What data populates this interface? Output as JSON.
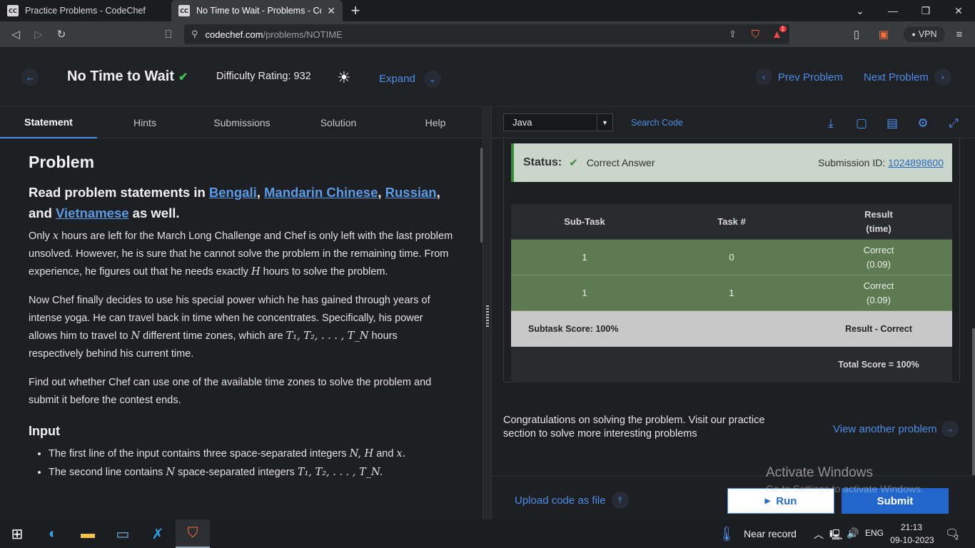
{
  "browser": {
    "tabs": [
      {
        "title": "Practice Problems - CodeChef",
        "favicon": "CC"
      },
      {
        "title": "No Time to Wait - Problems - Co",
        "favicon": "CC"
      }
    ],
    "url_host": "codechef.com",
    "url_path": "/problems/NOTIME",
    "vpn_label": "VPN",
    "badge_count": "1"
  },
  "header": {
    "title": "No Time to Wait",
    "difficulty": "Difficulty Rating: 932",
    "expand": "Expand",
    "prev": "Prev Problem",
    "next": "Next Problem"
  },
  "left_tabs": [
    "Statement",
    "Hints",
    "Submissions",
    "Solution",
    "Help"
  ],
  "statement": {
    "heading": "Problem",
    "read_prefix": "Read problem statements in",
    "langs": [
      "Bengali",
      "Mandarin Chinese",
      "Russian"
    ],
    "read_and": "and",
    "lang_last": "Vietnamese",
    "read_suffix": "as well.",
    "p1a": "Only",
    "p1x": "x",
    "p1b": "hours are left for the March Long Challenge and Chef is only left with the last problem unsolved. However, he is sure that he cannot solve the problem in the remaining time. From experience, he figures out that he needs exactly",
    "p1h": "H",
    "p1c": "hours to solve the problem.",
    "p2a": "Now Chef finally decides to use his special power which he has gained through years of intense yoga. He can travel back in time when he concentrates. Specifically, his power allows him to travel to",
    "p2n": "N",
    "p2b": "different time zones, which are",
    "p2t": "T₁, T₂, . . . , T_N",
    "p2c": "hours respectively behind his current time.",
    "p3": "Find out whether Chef can use one of the available time zones to solve the problem and submit it before the contest ends.",
    "input_heading": "Input",
    "b1a": "The first line of the input contains three space-separated integers",
    "b1m": "N, H",
    "b1and": "and",
    "b1x": "x.",
    "b2a": "The second line contains",
    "b2n": "N",
    "b2b": "space-separated integers",
    "b2t": "T₁, T₂, . . . , T_N."
  },
  "editor": {
    "language": "Java",
    "search_code": "Search Code"
  },
  "result": {
    "status_label": "Status:",
    "status_value": "Correct Answer",
    "submission_label": "Submission ID:",
    "submission_id": "1024898600",
    "table_headers": [
      "Sub-Task",
      "Task #",
      "Result\n(time)"
    ],
    "rows": [
      {
        "subtask": "1",
        "task": "0",
        "result": "Correct",
        "time": "(0.09)"
      },
      {
        "subtask": "1",
        "task": "1",
        "result": "Correct",
        "time": "(0.09)"
      }
    ],
    "subtask_score": "Subtask Score: 100%",
    "result_summary": "Result - Correct",
    "total_score": "Total Score = 100%"
  },
  "congrats": "Congratulations on solving the problem. Visit our practice section to solve more interesting problems",
  "view_another": "View another problem",
  "upload": "Upload code as file",
  "run": "Run",
  "submit": "Submit",
  "watermark": {
    "line1": "Activate Windows",
    "line2": "Go to Settings to activate Windows."
  },
  "taskbar": {
    "weather": "Near record",
    "lang": "ENG",
    "time": "21:13",
    "date": "09-10-2023",
    "notif_count": "2"
  }
}
